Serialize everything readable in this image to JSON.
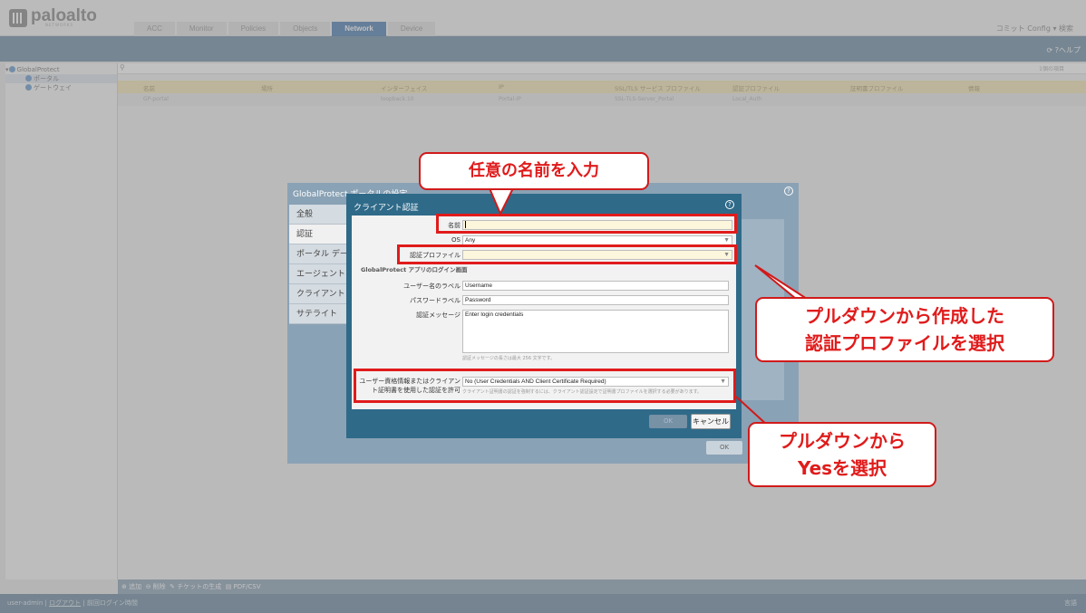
{
  "header": {
    "logo_text": "paloalto",
    "logo_sub": "NETWORKS",
    "tabs": [
      {
        "label": "ACC"
      },
      {
        "label": "Monitor"
      },
      {
        "label": "Policies"
      },
      {
        "label": "Objects"
      },
      {
        "label": "Network"
      },
      {
        "label": "Device"
      }
    ],
    "right": "コミット  Config ▾  検索",
    "subbar_right": "⟳ ?ヘルプ"
  },
  "tree": {
    "root": "GlobalProtect",
    "items": [
      "ポータル",
      "ゲートウェイ"
    ]
  },
  "table": {
    "filter_text": "1個の項目",
    "headers": [
      "名前",
      "場所",
      "インターフェイス",
      "IP",
      "SSL/TLS サービス プロファイル",
      "認証プロファイル",
      "証明書プロファイル",
      "情報"
    ],
    "row": [
      "GP-portal",
      "",
      "loopback.10",
      "Portal-IP",
      "SSL-TLS-Server_Portal",
      "Local_Auth",
      "",
      ""
    ]
  },
  "bottombar": {
    "add": "追加",
    "delete": "削除",
    "ticket": "チケットの生成",
    "pdf": "PDF/CSV"
  },
  "statusbar": {
    "user": "user-admin",
    "logout": "ログアウト",
    "last_login": "前回ログイン時間",
    "lang": "言語"
  },
  "portal_dialog": {
    "title": "GlobalProtect ポータルの設定",
    "tabs": [
      "全般",
      "認証",
      "ポータル デー",
      "エージェント",
      "クライアント",
      "サテライト"
    ],
    "ok": "OK"
  },
  "client_dialog": {
    "title": "クライアント認証",
    "name_label": "名前",
    "name_value": "",
    "os_label": "OS",
    "os_value": "Any",
    "auth_profile_label": "認証プロファイル",
    "auth_profile_value": "",
    "section_login": "GlobalProtect アプリのログイン画面",
    "username_label": "ユーザー名のラベル",
    "username_value": "Username",
    "password_label": "パスワードラベル",
    "password_value": "Password",
    "message_label": "認証メッセージ",
    "message_value": "Enter login credentials",
    "message_hint": "認証メッセージの長さは最大 256 文字です。",
    "cred_label_line1": "ユーザー資格情報またはクライアン",
    "cred_label_line2": "ト証明書を使用した認証を許可",
    "cred_value": "No (User Credentials AND Client Certificate Required)",
    "cred_hint": "クライアント証明書の認証を強制するには、クライアント認証設定で証明書プロファイルを選択する必要があります。",
    "ok": "OK",
    "cancel": "キャンセル"
  },
  "callouts": {
    "name": "任意の名前を入力",
    "auth_line1": "プルダウンから作成した",
    "auth_line2": "認証プロファイルを選択",
    "yes_line1": "プルダウンから",
    "yes_line2": "Yesを選択"
  },
  "colors": {
    "highlight": "#e01b1b",
    "dialog_header": "#2f6a89",
    "active_tab": "#4f7fb3"
  }
}
